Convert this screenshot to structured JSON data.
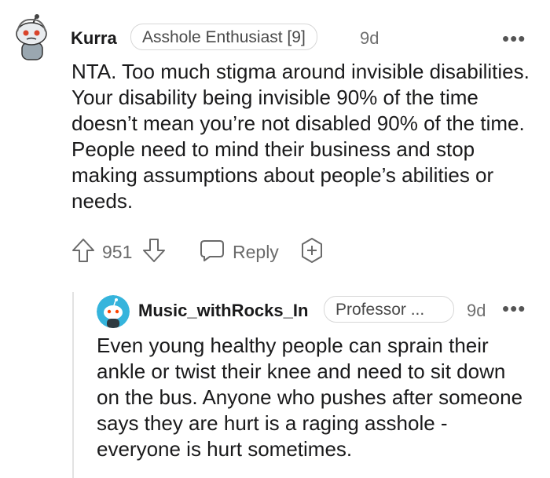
{
  "comment": {
    "username": "Kurra",
    "flair": "Asshole Enthusiast [9]",
    "time": "9d",
    "more": "•••",
    "body": "NTA. Too much stigma around invisible disabilities. Your disability being invisible 90% of the time doesn’t mean you’re not disabled 90% of the time. People need to mind their business and stop making assumptions about people’s abilities or needs.",
    "votes": "951",
    "reply_label": "Reply"
  },
  "reply": {
    "username": "Music_withRocks_In",
    "flair": "Professor ...",
    "time": "9d",
    "more": "•••",
    "body": "Even young healthy people can sprain their ankle or twist their knee and need to sit down on the bus. Anyone who pushes after someone says they are hurt is a raging asshole - everyone is hurt sometimes."
  },
  "icons": {
    "avatar_main": "snoo-avatar",
    "avatar_reply": "snoo-avatar",
    "upvote": "arrow-up-icon",
    "downvote": "arrow-down-icon",
    "reply": "comment-bubble-icon",
    "award": "award-plus-icon"
  }
}
